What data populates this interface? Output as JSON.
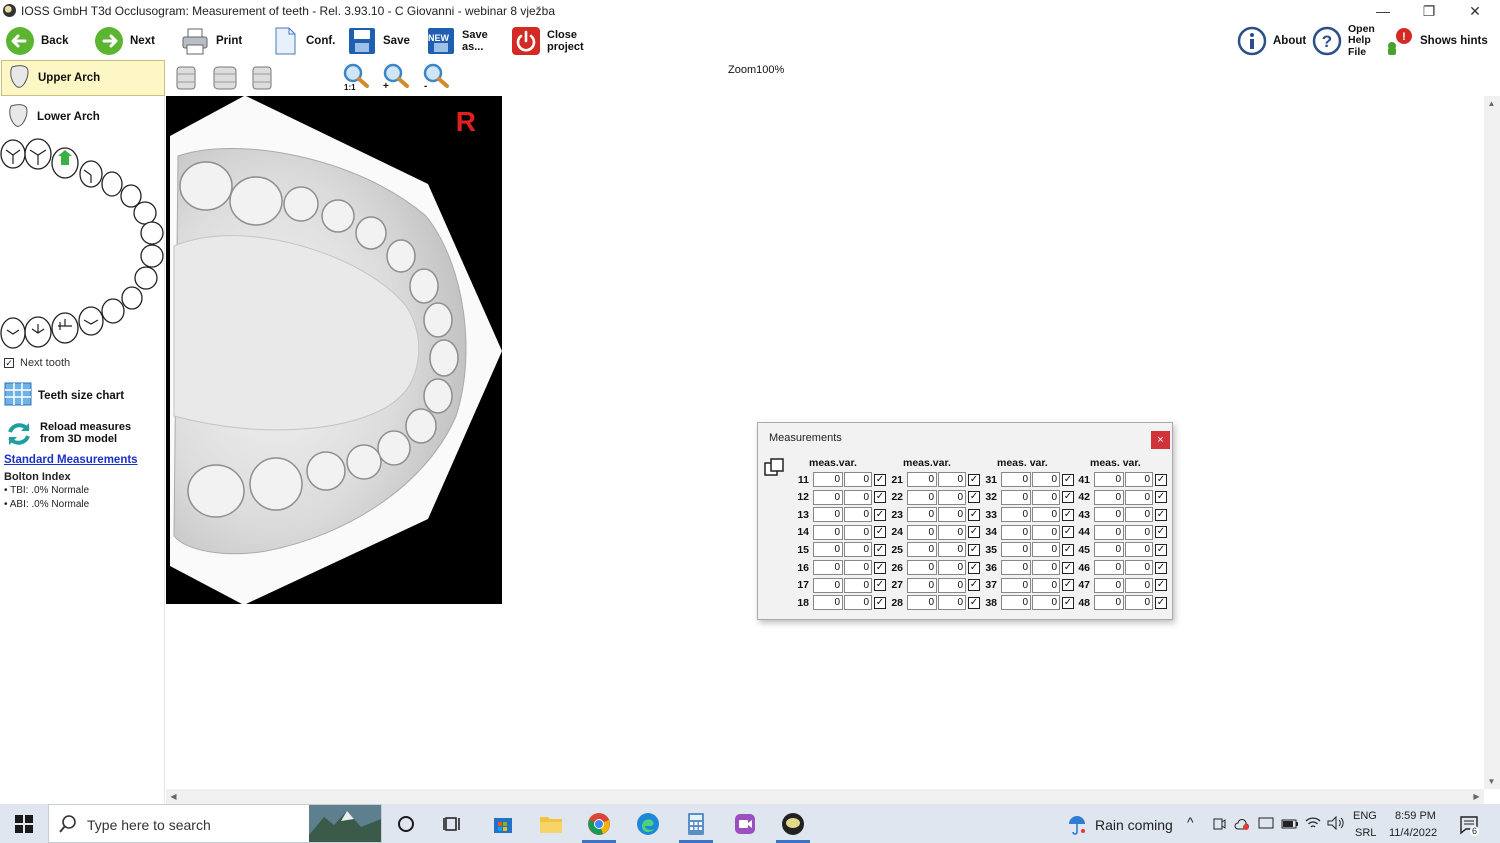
{
  "window": {
    "title": "IOSS GmbH T3d Occlusogram: Measurement of teeth - Rel. 3.93.10 - C Giovanni - webinar 8 vježba",
    "minimize": "—",
    "restore": "❐",
    "close": "✕"
  },
  "toolbar": {
    "back": "Back",
    "next": "Next",
    "print": "Print",
    "conf": "Conf.",
    "save": "Save",
    "save_as_1": "Save",
    "save_as_2": "as...",
    "new_badge": "NEW",
    "close_project_1": "Close",
    "close_project_2": "project",
    "about": "About",
    "help_1": "Open",
    "help_2": "Help",
    "help_3": "File",
    "hints": "Shows hints"
  },
  "view_tools": {
    "zoom_label": "Zoom100%",
    "zoom_1to1_label": "1:1",
    "zoom_in_label": "+",
    "zoom_out_label": "-"
  },
  "left_panel": {
    "upper_arch": "Upper Arch",
    "lower_arch": "Lower Arch",
    "next_tooth_checked": true,
    "next_tooth": "Next tooth",
    "teeth_size_chart": "Teeth size chart",
    "reload_1": "Reload measures",
    "reload_2": "from 3D model",
    "standard_measurements": "Standard Measurements",
    "bolton_title": "Bolton Index",
    "tbi": "• TBI: .0% Normale",
    "abi": "• ABI: .0% Normale"
  },
  "model_view": {
    "side_marker": "R"
  },
  "measurements": {
    "title": "Measurements",
    "close": "×",
    "groups": [
      {
        "header": "meas.var.",
        "rows": [
          {
            "tooth": "11",
            "meas": "0",
            "var": "0",
            "checked": true
          },
          {
            "tooth": "12",
            "meas": "0",
            "var": "0",
            "checked": true
          },
          {
            "tooth": "13",
            "meas": "0",
            "var": "0",
            "checked": true
          },
          {
            "tooth": "14",
            "meas": "0",
            "var": "0",
            "checked": true
          },
          {
            "tooth": "15",
            "meas": "0",
            "var": "0",
            "checked": true
          },
          {
            "tooth": "16",
            "meas": "0",
            "var": "0",
            "checked": true
          },
          {
            "tooth": "17",
            "meas": "0",
            "var": "0",
            "checked": true
          },
          {
            "tooth": "18",
            "meas": "0",
            "var": "0",
            "checked": true
          }
        ]
      },
      {
        "header": "meas.var.",
        "rows": [
          {
            "tooth": "21",
            "meas": "0",
            "var": "0",
            "checked": true
          },
          {
            "tooth": "22",
            "meas": "0",
            "var": "0",
            "checked": true
          },
          {
            "tooth": "23",
            "meas": "0",
            "var": "0",
            "checked": true
          },
          {
            "tooth": "24",
            "meas": "0",
            "var": "0",
            "checked": true
          },
          {
            "tooth": "25",
            "meas": "0",
            "var": "0",
            "checked": true
          },
          {
            "tooth": "26",
            "meas": "0",
            "var": "0",
            "checked": true
          },
          {
            "tooth": "27",
            "meas": "0",
            "var": "0",
            "checked": true
          },
          {
            "tooth": "28",
            "meas": "0",
            "var": "0",
            "checked": true
          }
        ]
      },
      {
        "header": "meas. var.",
        "rows": [
          {
            "tooth": "31",
            "meas": "0",
            "var": "0",
            "checked": true
          },
          {
            "tooth": "32",
            "meas": "0",
            "var": "0",
            "checked": true
          },
          {
            "tooth": "33",
            "meas": "0",
            "var": "0",
            "checked": true
          },
          {
            "tooth": "34",
            "meas": "0",
            "var": "0",
            "checked": true
          },
          {
            "tooth": "35",
            "meas": "0",
            "var": "0",
            "checked": true
          },
          {
            "tooth": "36",
            "meas": "0",
            "var": "0",
            "checked": true
          },
          {
            "tooth": "37",
            "meas": "0",
            "var": "0",
            "checked": true
          },
          {
            "tooth": "38",
            "meas": "0",
            "var": "0",
            "checked": true
          }
        ]
      },
      {
        "header": "meas. var.",
        "rows": [
          {
            "tooth": "41",
            "meas": "0",
            "var": "0",
            "checked": true
          },
          {
            "tooth": "42",
            "meas": "0",
            "var": "0",
            "checked": true
          },
          {
            "tooth": "43",
            "meas": "0",
            "var": "0",
            "checked": true
          },
          {
            "tooth": "44",
            "meas": "0",
            "var": "0",
            "checked": true
          },
          {
            "tooth": "45",
            "meas": "0",
            "var": "0",
            "checked": true
          },
          {
            "tooth": "46",
            "meas": "0",
            "var": "0",
            "checked": true
          },
          {
            "tooth": "47",
            "meas": "0",
            "var": "0",
            "checked": true
          },
          {
            "tooth": "48",
            "meas": "0",
            "var": "0",
            "checked": true
          }
        ]
      }
    ]
  },
  "taskbar": {
    "search_placeholder": "Type here to search",
    "weather": "Rain coming",
    "lang_1": "ENG",
    "lang_2": "SRL",
    "time": "8:59 PM",
    "date": "11/4/2022",
    "notification_count": "6"
  },
  "icons": [
    "back-arrow-icon",
    "next-arrow-icon",
    "printer-icon",
    "document-icon",
    "floppy-icon",
    "new-floppy-icon",
    "power-icon",
    "info-icon",
    "help-icon",
    "hints-icon",
    "zoom-icon",
    "tooth-icon",
    "grid-chart-icon",
    "refresh-icon",
    "windows-icon",
    "search-icon",
    "cortana-icon",
    "task-view-icon",
    "store-icon",
    "folder-icon",
    "chrome-icon",
    "edge-icon",
    "calculator-icon",
    "video-icon",
    "ioss-icon"
  ]
}
